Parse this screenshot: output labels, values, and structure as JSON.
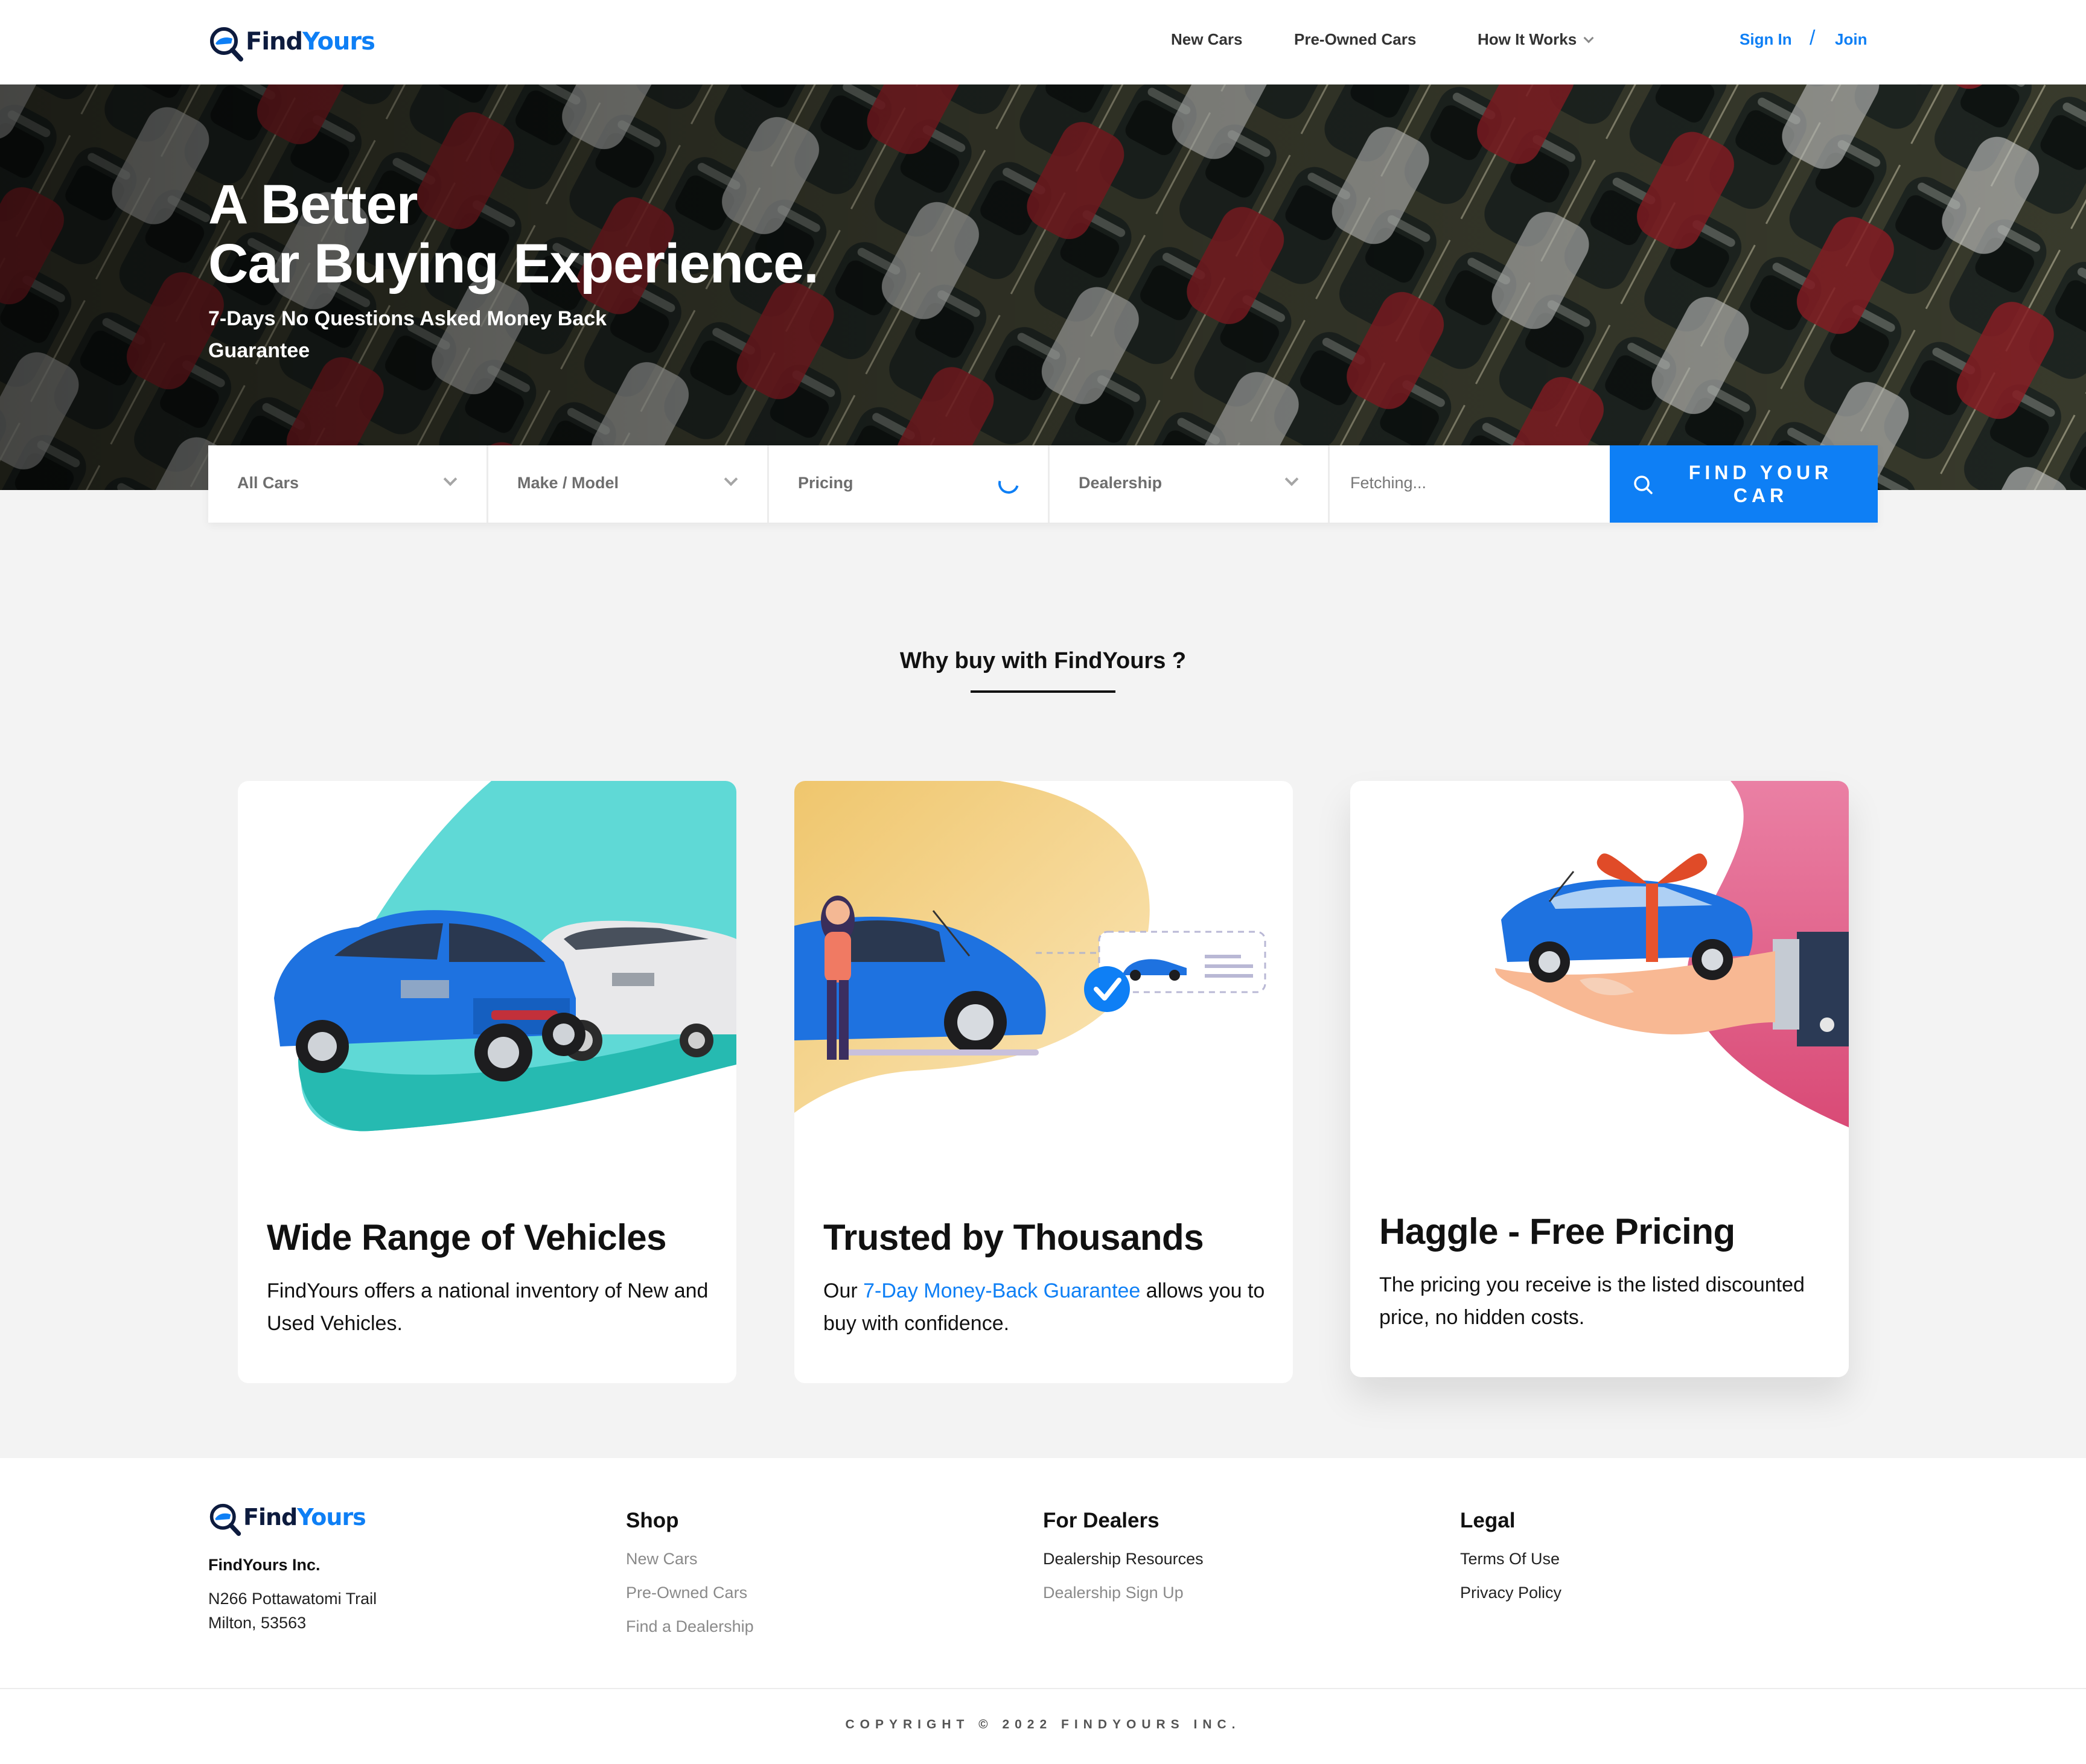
{
  "brand": {
    "find": "Find",
    "yours": "Yours"
  },
  "nav": {
    "links": [
      "New Cars",
      "Pre-Owned Cars",
      "How It Works"
    ],
    "sign_in": "Sign In",
    "separator": "/",
    "join": "Join"
  },
  "hero": {
    "title_line1": "A Better",
    "title_line2": "Car Buying Experience.",
    "subtitle": "7-Days No Questions Asked Money Back Guarantee"
  },
  "search": {
    "fields": [
      {
        "label": "All Cars",
        "icon": "chevron-down-icon"
      },
      {
        "label": "Make / Model",
        "icon": "chevron-down-icon"
      },
      {
        "label": "Pricing",
        "icon": "loading-spinner-icon"
      },
      {
        "label": "Dealership",
        "icon": "chevron-down-icon"
      },
      {
        "label": "Fetching...",
        "icon": ""
      }
    ],
    "button_label": "FIND YOUR CAR"
  },
  "why": {
    "title": "Why buy with FindYours ?",
    "cards": [
      {
        "title": "Wide Range of Vehicles",
        "text": "FindYours offers a national inventory of New and Used Vehicles."
      },
      {
        "title": "Trusted by Thousands",
        "text_before": "Our ",
        "link": "7-Day Money-Back Guarantee",
        "text_after": " allows you to buy with confidence."
      },
      {
        "title": "Haggle - Free Pricing",
        "text": "The pricing you receive is the listed discounted price, no hidden costs."
      }
    ]
  },
  "footer": {
    "company": "FindYours Inc.",
    "address_line1": "N266 Pottawatomi Trail",
    "address_line2": "Milton, 53563",
    "columns": [
      {
        "title": "Shop",
        "links": [
          "New Cars",
          "Pre-Owned Cars",
          "Find a Dealership"
        ]
      },
      {
        "title": "For Dealers",
        "links": [
          "Dealership Resources",
          "Dealership Sign Up"
        ]
      },
      {
        "title": "Legal",
        "links": [
          "Terms Of Use",
          "Privacy Policy"
        ]
      }
    ],
    "copyright": "COPYRIGHT © 2022 FINDYOURS INC."
  },
  "colors": {
    "accent": "#0e7ff5",
    "navy": "#0d1b3e",
    "teal": "#3cc8c0",
    "pink": "#e05a86",
    "gold": "#f2c86a"
  }
}
